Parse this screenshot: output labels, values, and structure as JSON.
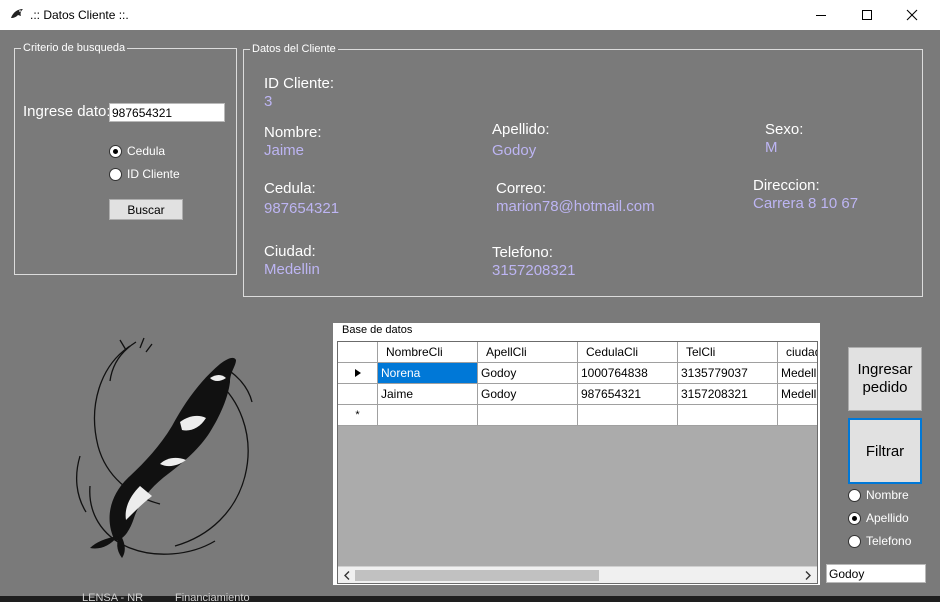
{
  "window": {
    "title": ".:: Datos Cliente ::."
  },
  "search_group": {
    "caption": "Criterio de busqueda",
    "input_label": "Ingrese dato:",
    "input_value": "987654321",
    "radio_cedula": "Cedula",
    "radio_id": "ID Cliente",
    "selected": "Cedula",
    "search_button": "Buscar"
  },
  "client_group": {
    "caption": "Datos del Cliente",
    "id_label": "ID Cliente:",
    "id_value": "3",
    "nombre_label": "Nombre:",
    "nombre_value": "Jaime",
    "apellido_label": "Apellido:",
    "apellido_value": "Godoy",
    "sexo_label": "Sexo:",
    "sexo_value": "M",
    "cedula_label": "Cedula:",
    "cedula_value": "987654321",
    "correo_label": "Correo:",
    "correo_value": "marion78@hotmail.com",
    "direccion_label": "Direccion:",
    "direccion_value": "Carrera 8 10 67",
    "ciudad_label": "Ciudad:",
    "ciudad_value": "Medellin",
    "telefono_label": "Telefono:",
    "telefono_value": "3157208321"
  },
  "database": {
    "caption": "Base de datos",
    "columns": [
      "NombreCli",
      "ApellCli",
      "CedulaCli",
      "TelCli",
      "ciudad"
    ],
    "rows": [
      [
        "Norena",
        "Godoy",
        "1000764838",
        "3135779037",
        "Medellin"
      ],
      [
        "Jaime",
        "Godoy",
        "987654321",
        "3157208321",
        "Medellin"
      ]
    ],
    "new_row_marker": "*"
  },
  "actions": {
    "ingresar_pedido": "Ingresar pedido",
    "filtrar": "Filtrar",
    "filter_options": [
      "Nombre",
      "Apellido",
      "Telefono"
    ],
    "filter_selected": "Apellido",
    "filter_value": "Godoy"
  },
  "background_text": {
    "left": "LENSA - NR",
    "right": "Financiamiento"
  },
  "colors": {
    "form_bg": "#7a7a7a",
    "value_text": "#bdb5f3",
    "selection": "#0078d7"
  }
}
